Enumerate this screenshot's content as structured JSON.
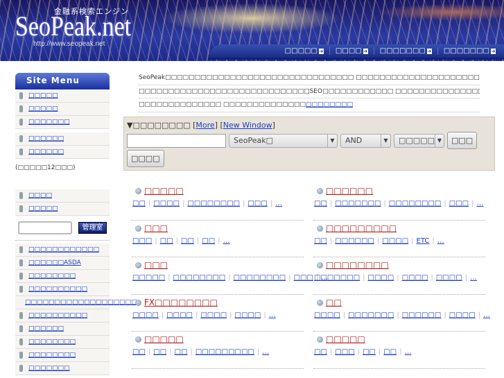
{
  "header": {
    "logo": "SeoPeak.net",
    "tagline": "金融系検索エンジン",
    "url": "http://www.seopeak.net",
    "nav": [
      "□□□□□",
      "□□□□",
      "□□□□□□□",
      "□□□□□□□"
    ]
  },
  "sidebar": {
    "title": "Site Menu",
    "group1": [
      "□□□□□",
      "□□□□□",
      "□□□□□□□",
      "□□□□□□",
      "□□□□□□"
    ],
    "note": "(□□□□□12□□□)",
    "group2": [
      "□□□□",
      "□□□□□"
    ],
    "admin_button": "管理室",
    "group3": [
      "□□□□□□□□□□□□",
      "□□□□□□ASDA",
      "□□□□□□□□",
      "□□□□□□□□□□",
      "□□□□□□□□□□□□□□□□□□□",
      "□□□□□□□□□□",
      "□□□□□□",
      "□□□□□□□□",
      "□□□□□□□□",
      "□□□□□□□"
    ]
  },
  "intro": {
    "lines": [
      "SeoPeak□□□□□□□□□□□□□□□□□□□□□□□□□□□□□□□□ □□□□□□□□□□□□□□□□□□□□□□□□□□□□□□□□□□□ □□□□□□□□□□□□□□",
      "□□□□□□□□□□□□□□□□□□□□□□□□□□□□□SEO□□□□□□□□□□□□ □□□□□□□□□□□□□□□□□□□□□□□□□□□□□□□□□□□□□□□□□□□□□□",
      "□□□□□□□□□□□□□□ □□□□□□□□□□□□□□"
    ],
    "link": "□□□□□□□□"
  },
  "search": {
    "title": "▼□□□□□□□□",
    "more": "More",
    "new_window": "New Window",
    "keyword": "",
    "target": "SeoPeak□",
    "mode": "AND",
    "sort": "□□□□□",
    "search_button": "□□□",
    "detail_button": "□□□□"
  },
  "categories": [
    {
      "title": "□□□□□",
      "links": [
        "□□",
        "□□□□",
        "□□□□□□□□",
        "□□□",
        "…"
      ]
    },
    {
      "title": "□□□□□□",
      "links": [
        "□□",
        "□□□□□□□",
        "□□□□□□□□",
        "□□□",
        "…"
      ]
    },
    {
      "title": "□□□",
      "links": [
        "□□□",
        "□□",
        "□□",
        "□□",
        "…"
      ]
    },
    {
      "title": "□□□□□□□□□",
      "links": [
        "□□",
        "□□□□□□",
        "□□□□",
        "ETC",
        "…"
      ]
    },
    {
      "title": "□□□",
      "links": [
        "□□□□□",
        "□□□□□□□□",
        "□□□□□□□□",
        "□□□",
        "…"
      ]
    },
    {
      "title": "□□□□□□□□",
      "links": [
        "□□□□□□□",
        "□□□□",
        "□□□□",
        "□□□□",
        "…"
      ]
    },
    {
      "title": "FX□□□□□□□□",
      "links": [
        "□□□□",
        "□□□□",
        "□□□□",
        "□□□□",
        "…"
      ]
    },
    {
      "title": "□□",
      "links": [
        "□□□□",
        "□□□□□□□",
        "□□□□□□",
        "□□□□",
        "…"
      ]
    },
    {
      "title": "□□□□□",
      "links": [
        "□□",
        "□□",
        "□□",
        "□□□□□□□□□",
        "…"
      ]
    },
    {
      "title": "□□□□□",
      "links": [
        "□□",
        "□□□",
        "□□",
        "□□",
        "…"
      ]
    }
  ]
}
